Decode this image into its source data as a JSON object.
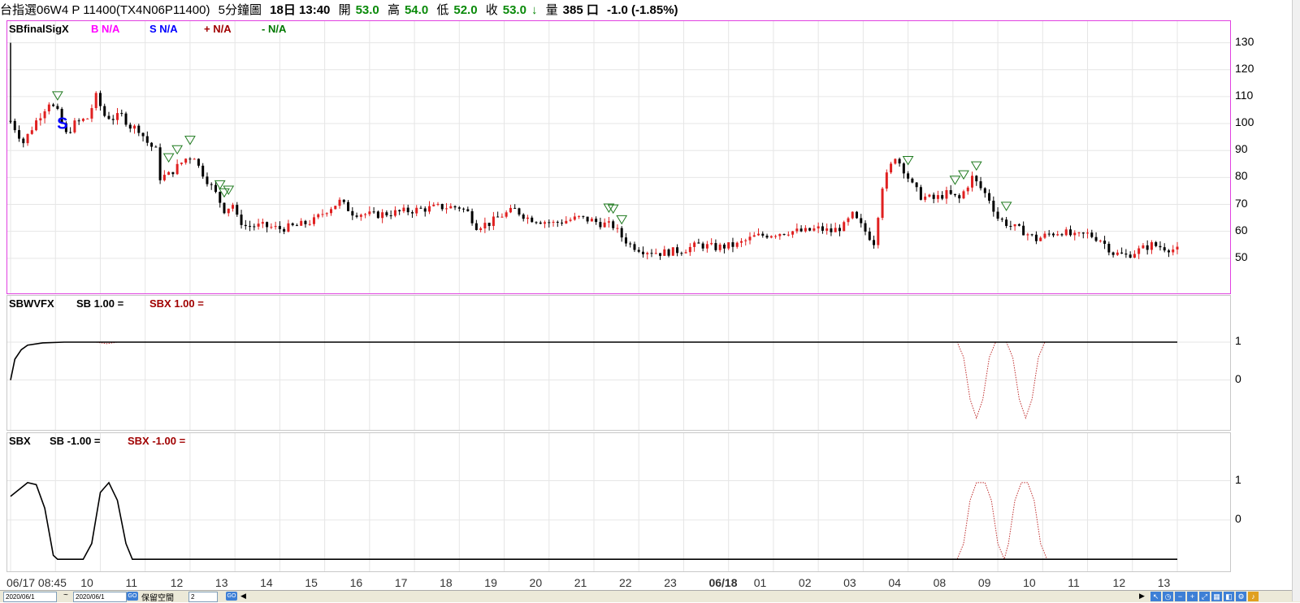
{
  "header": {
    "symbol": "台指選06W4 P 11400(TX4N06P11400)",
    "period": "5分鐘圖",
    "datetime": "18日 13:40",
    "open_label": "開",
    "open": "53.0",
    "high_label": "高",
    "high": "54.0",
    "low_label": "低",
    "low": "52.0",
    "close_label": "收",
    "close": "53.0",
    "vol_label": "量",
    "volume": "385 口",
    "change": "-1.0 (-1.85%)"
  },
  "panel1": {
    "name": "SBfinalSigX",
    "b": "B N/A",
    "s": "S N/A",
    "plus": "+ N/A",
    "minus": "- N/A",
    "b_color": "#ff00ff",
    "s_color": "#0000ff",
    "plus_color": "#a00000",
    "minus_color": "#007700",
    "marker": "S",
    "ticks": [
      "130",
      "120",
      "110",
      "100",
      "90",
      "80",
      "70",
      "60",
      "50"
    ]
  },
  "panel2": {
    "name": "SBWVFX",
    "sb": "SB 1.00 =",
    "sbx": "SBX 1.00 =",
    "ticks": [
      "1",
      "0"
    ]
  },
  "panel3": {
    "name": "SBX",
    "sb": "SB -1.00 =",
    "sbx": "SBX -1.00 =",
    "ticks": [
      "1",
      "0"
    ]
  },
  "xaxis": [
    "06/17 08:45",
    "10",
    "11",
    "12",
    "13",
    "14",
    "15",
    "16",
    "17",
    "18",
    "19",
    "20",
    "21",
    "22",
    "23",
    "06/18",
    "01",
    "02",
    "03",
    "04",
    "08",
    "09",
    "10",
    "11",
    "12",
    "13"
  ],
  "bottom": {
    "date1": "2020/06/1",
    "sep": "~",
    "date2": "2020/06/1",
    "go": "GO",
    "keep_label": "保留空間",
    "keep_val": "2"
  },
  "chart_data": [
    {
      "type": "candlestick",
      "title": "SBfinalSigX",
      "ylim": [
        40,
        135
      ],
      "yticks": [
        130,
        120,
        110,
        100,
        90,
        80,
        70,
        60,
        50
      ],
      "up_color": "#e02020",
      "down_color": "#000000",
      "close_points": [
        [
          0,
          101
        ],
        [
          6,
          93
        ],
        [
          12,
          101
        ],
        [
          18,
          108
        ],
        [
          22,
          104
        ],
        [
          26,
          96
        ],
        [
          30,
          100
        ],
        [
          36,
          102
        ],
        [
          40,
          110
        ],
        [
          44,
          103
        ],
        [
          48,
          102
        ],
        [
          52,
          103
        ],
        [
          56,
          99
        ],
        [
          60,
          98
        ],
        [
          64,
          93
        ],
        [
          68,
          90
        ],
        [
          70,
          80
        ],
        [
          74,
          81
        ],
        [
          78,
          84
        ],
        [
          82,
          87
        ],
        [
          86,
          88
        ],
        [
          88,
          84
        ],
        [
          92,
          79
        ],
        [
          96,
          74
        ],
        [
          100,
          68
        ],
        [
          104,
          70
        ],
        [
          106,
          65
        ],
        [
          110,
          62
        ],
        [
          118,
          62
        ],
        [
          126,
          61
        ],
        [
          134,
          62
        ],
        [
          142,
          64
        ],
        [
          148,
          68
        ],
        [
          154,
          71
        ],
        [
          160,
          67
        ],
        [
          170,
          66
        ],
        [
          180,
          67
        ],
        [
          190,
          68
        ],
        [
          200,
          69
        ],
        [
          210,
          69
        ],
        [
          214,
          67
        ],
        [
          218,
          62
        ],
        [
          224,
          63
        ],
        [
          230,
          66
        ],
        [
          236,
          68
        ],
        [
          242,
          65
        ],
        [
          248,
          64
        ],
        [
          254,
          63
        ],
        [
          260,
          64
        ],
        [
          266,
          65
        ],
        [
          272,
          64
        ],
        [
          276,
          63
        ],
        [
          282,
          62
        ],
        [
          286,
          58
        ],
        [
          290,
          55
        ],
        [
          296,
          53
        ],
        [
          304,
          52
        ],
        [
          314,
          53
        ],
        [
          322,
          55
        ],
        [
          330,
          54
        ],
        [
          340,
          55
        ],
        [
          348,
          58
        ],
        [
          356,
          59
        ],
        [
          364,
          60
        ],
        [
          372,
          60
        ],
        [
          378,
          61
        ],
        [
          384,
          60
        ],
        [
          390,
          62
        ],
        [
          394,
          66
        ],
        [
          398,
          62
        ],
        [
          404,
          56
        ],
        [
          408,
          77
        ],
        [
          414,
          88
        ],
        [
          418,
          83
        ],
        [
          422,
          77
        ],
        [
          426,
          73
        ],
        [
          432,
          72
        ],
        [
          438,
          74
        ],
        [
          444,
          72
        ],
        [
          450,
          80
        ],
        [
          454,
          76
        ],
        [
          458,
          72
        ],
        [
          462,
          65
        ],
        [
          468,
          62
        ],
        [
          474,
          60
        ],
        [
          480,
          57
        ],
        [
          486,
          59
        ],
        [
          492,
          60
        ],
        [
          498,
          58
        ],
        [
          504,
          59
        ],
        [
          510,
          57
        ],
        [
          516,
          52
        ],
        [
          522,
          51
        ],
        [
          528,
          53
        ],
        [
          534,
          55
        ],
        [
          540,
          54
        ],
        [
          546,
          53
        ]
      ],
      "x_domain": [
        0,
        546
      ],
      "down_signals": [
        22,
        74,
        78,
        84,
        98,
        100,
        102,
        280,
        282,
        286,
        420,
        442,
        446,
        452,
        466
      ],
      "s_marker_at": 24
    },
    {
      "type": "line",
      "title": "SBWVFX",
      "ylim": [
        -1.1,
        1.9
      ],
      "yticks": [
        1,
        0
      ],
      "series": [
        {
          "name": "SB",
          "color": "#000000",
          "style": "solid",
          "points": [
            [
              0,
              0
            ],
            [
              2,
              0.55
            ],
            [
              5,
              0.8
            ],
            [
              8,
              0.92
            ],
            [
              15,
              0.98
            ],
            [
              25,
              1
            ],
            [
              546,
              1
            ]
          ]
        },
        {
          "name": "SBX",
          "color": "#c03030",
          "style": "dotted",
          "points": [
            [
              0,
              0
            ],
            [
              2,
              0.55
            ],
            [
              5,
              0.8
            ],
            [
              8,
              0.92
            ],
            [
              15,
              0.98
            ],
            [
              25,
              1
            ],
            [
              40,
              1
            ],
            [
              45,
              0.96
            ],
            [
              50,
              1
            ],
            [
              443,
              1
            ],
            [
              446,
              0.6
            ],
            [
              449,
              -0.5
            ],
            [
              452,
              -1
            ],
            [
              455,
              -0.5
            ],
            [
              458,
              0.6
            ],
            [
              461,
              1
            ],
            [
              466,
              1
            ],
            [
              469,
              0.6
            ],
            [
              472,
              -0.5
            ],
            [
              475,
              -1
            ],
            [
              478,
              -0.5
            ],
            [
              481,
              0.6
            ],
            [
              484,
              1
            ],
            [
              546,
              1
            ]
          ]
        }
      ],
      "x_domain": [
        0,
        546
      ]
    },
    {
      "type": "line",
      "title": "SBX",
      "ylim": [
        -1.1,
        1.9
      ],
      "yticks": [
        1,
        0
      ],
      "series": [
        {
          "name": "SB",
          "color": "#000000",
          "style": "solid",
          "points": [
            [
              0,
              0.6
            ],
            [
              8,
              0.95
            ],
            [
              12,
              0.9
            ],
            [
              16,
              0.3
            ],
            [
              20,
              -0.9
            ],
            [
              22,
              -1
            ],
            [
              34,
              -1
            ],
            [
              38,
              -0.6
            ],
            [
              42,
              0.7
            ],
            [
              46,
              0.95
            ],
            [
              50,
              0.5
            ],
            [
              54,
              -0.6
            ],
            [
              57,
              -1
            ],
            [
              546,
              -1
            ]
          ]
        },
        {
          "name": "SBX",
          "color": "#c03030",
          "style": "dotted",
          "points": [
            [
              0,
              0.6
            ],
            [
              8,
              0.95
            ],
            [
              12,
              0.9
            ],
            [
              16,
              0.3
            ],
            [
              20,
              -0.9
            ],
            [
              22,
              -1
            ],
            [
              34,
              -1
            ],
            [
              38,
              -0.6
            ],
            [
              42,
              0.7
            ],
            [
              46,
              0.95
            ],
            [
              50,
              0.5
            ],
            [
              54,
              -0.6
            ],
            [
              57,
              -1
            ],
            [
              443,
              -1
            ],
            [
              446,
              -0.6
            ],
            [
              449,
              0.5
            ],
            [
              452,
              0.95
            ],
            [
              456,
              0.95
            ],
            [
              459,
              0.5
            ],
            [
              462,
              -0.6
            ],
            [
              465,
              -1
            ],
            [
              467,
              -0.6
            ],
            [
              470,
              0.5
            ],
            [
              473,
              0.95
            ],
            [
              476,
              0.95
            ],
            [
              479,
              0.5
            ],
            [
              482,
              -0.6
            ],
            [
              485,
              -1
            ],
            [
              546,
              -1
            ]
          ]
        }
      ],
      "x_domain": [
        0,
        546
      ]
    }
  ]
}
